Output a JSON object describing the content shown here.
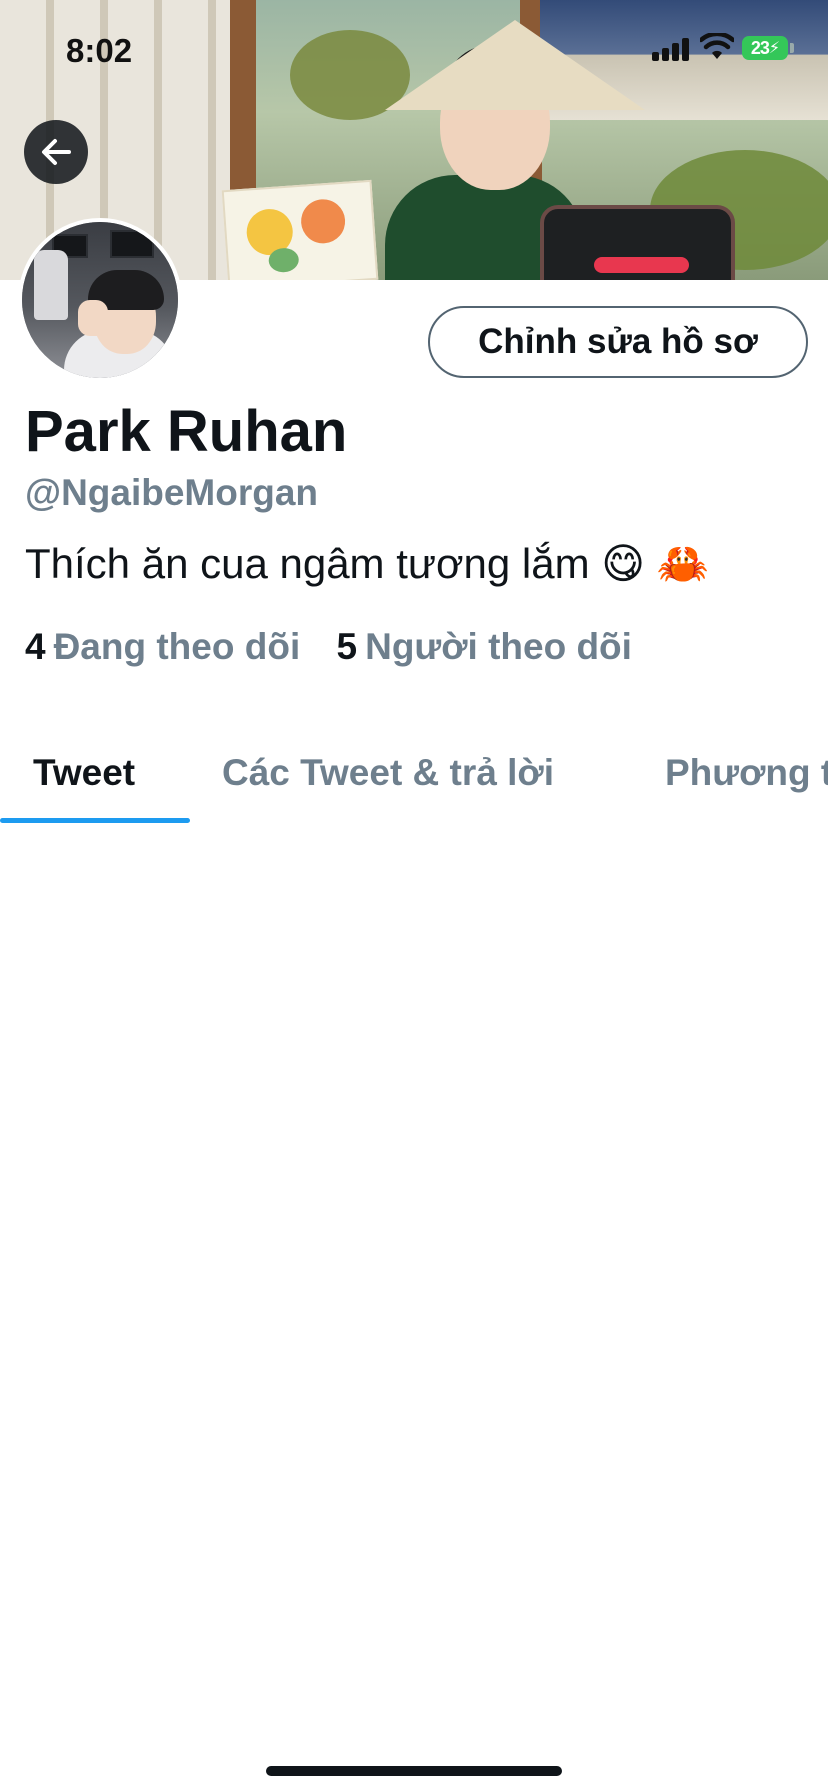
{
  "status_bar": {
    "time": "8:02",
    "battery": "23",
    "icons": [
      "signal-icon",
      "wifi-icon",
      "battery-charging-icon"
    ]
  },
  "header": {
    "back_icon": "arrow-left-icon"
  },
  "profile": {
    "edit_button_label": "Chỉnh sửa hồ sơ",
    "display_name": "Park Ruhan",
    "username": "@NgaibeMorgan",
    "bio": "Thích ăn cua ngâm tương lắm 😋 🦀",
    "following_count": "4",
    "following_label": "Đang theo dõi",
    "followers_count": "5",
    "followers_label": "Người theo dõi"
  },
  "tabs": [
    {
      "label": "Tweet",
      "active": true
    },
    {
      "label": "Các Tweet & trả lời",
      "active": false
    },
    {
      "label": "Phương tiện",
      "active": false
    }
  ],
  "colors": {
    "accent": "#1d9bf0",
    "secondary_text": "#6e7f8d",
    "primary_text": "#0f1419",
    "battery": "#34c759"
  }
}
